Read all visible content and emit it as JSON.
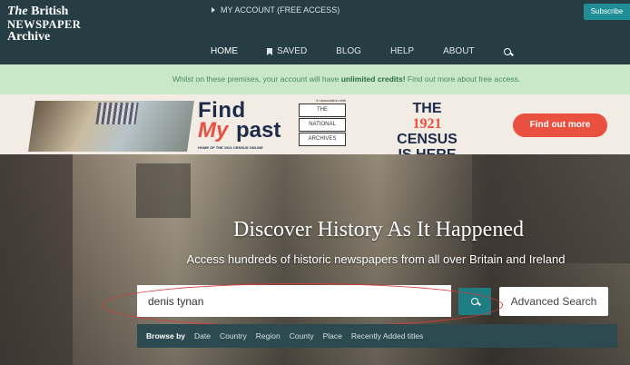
{
  "header": {
    "logo": {
      "line1_italic": "The",
      "line1_rest": "British",
      "line2": "NEWSPAPER",
      "line3": "Archive"
    },
    "account_link": "MY ACCOUNT (FREE ACCESS)",
    "subscribe_label": "Subscribe",
    "nav": [
      {
        "label": "HOME",
        "icon": ""
      },
      {
        "label": "SAVED",
        "icon": "bookmark-icon"
      },
      {
        "label": "BLOG",
        "icon": ""
      },
      {
        "label": "HELP",
        "icon": ""
      },
      {
        "label": "ABOUT",
        "icon": ""
      }
    ]
  },
  "notice": {
    "before": "Whilst on these premises, your account will have",
    "bold": "unlimited credits!",
    "after": "Find out more about free access."
  },
  "banner": {
    "find": "Find",
    "my": "My",
    "past": "past",
    "tagline": "HOME OF THE 1921 CENSUS ONLINE",
    "association": "In association with",
    "national_archives": [
      "THE",
      "NATIONAL",
      "ARCHIVES"
    ],
    "census_lines": [
      "THE",
      "1921",
      "CENSUS",
      "IS HERE"
    ],
    "cta": "Find out more"
  },
  "hero": {
    "headline": "Discover History As It Happened",
    "subline": "Access hundreds of historic newspapers from all over Britain and Ireland",
    "search_value": "denis tynan",
    "advanced_label": "Advanced Search"
  },
  "browse": {
    "label": "Browse by",
    "options": [
      "Date",
      "Country",
      "Region",
      "County",
      "Place",
      "Recently Added titles"
    ]
  },
  "colors": {
    "header_bg": "#253d43",
    "accent": "#1f7d84",
    "notice_bg": "#c9e8c7",
    "cta": "#e9503f"
  }
}
